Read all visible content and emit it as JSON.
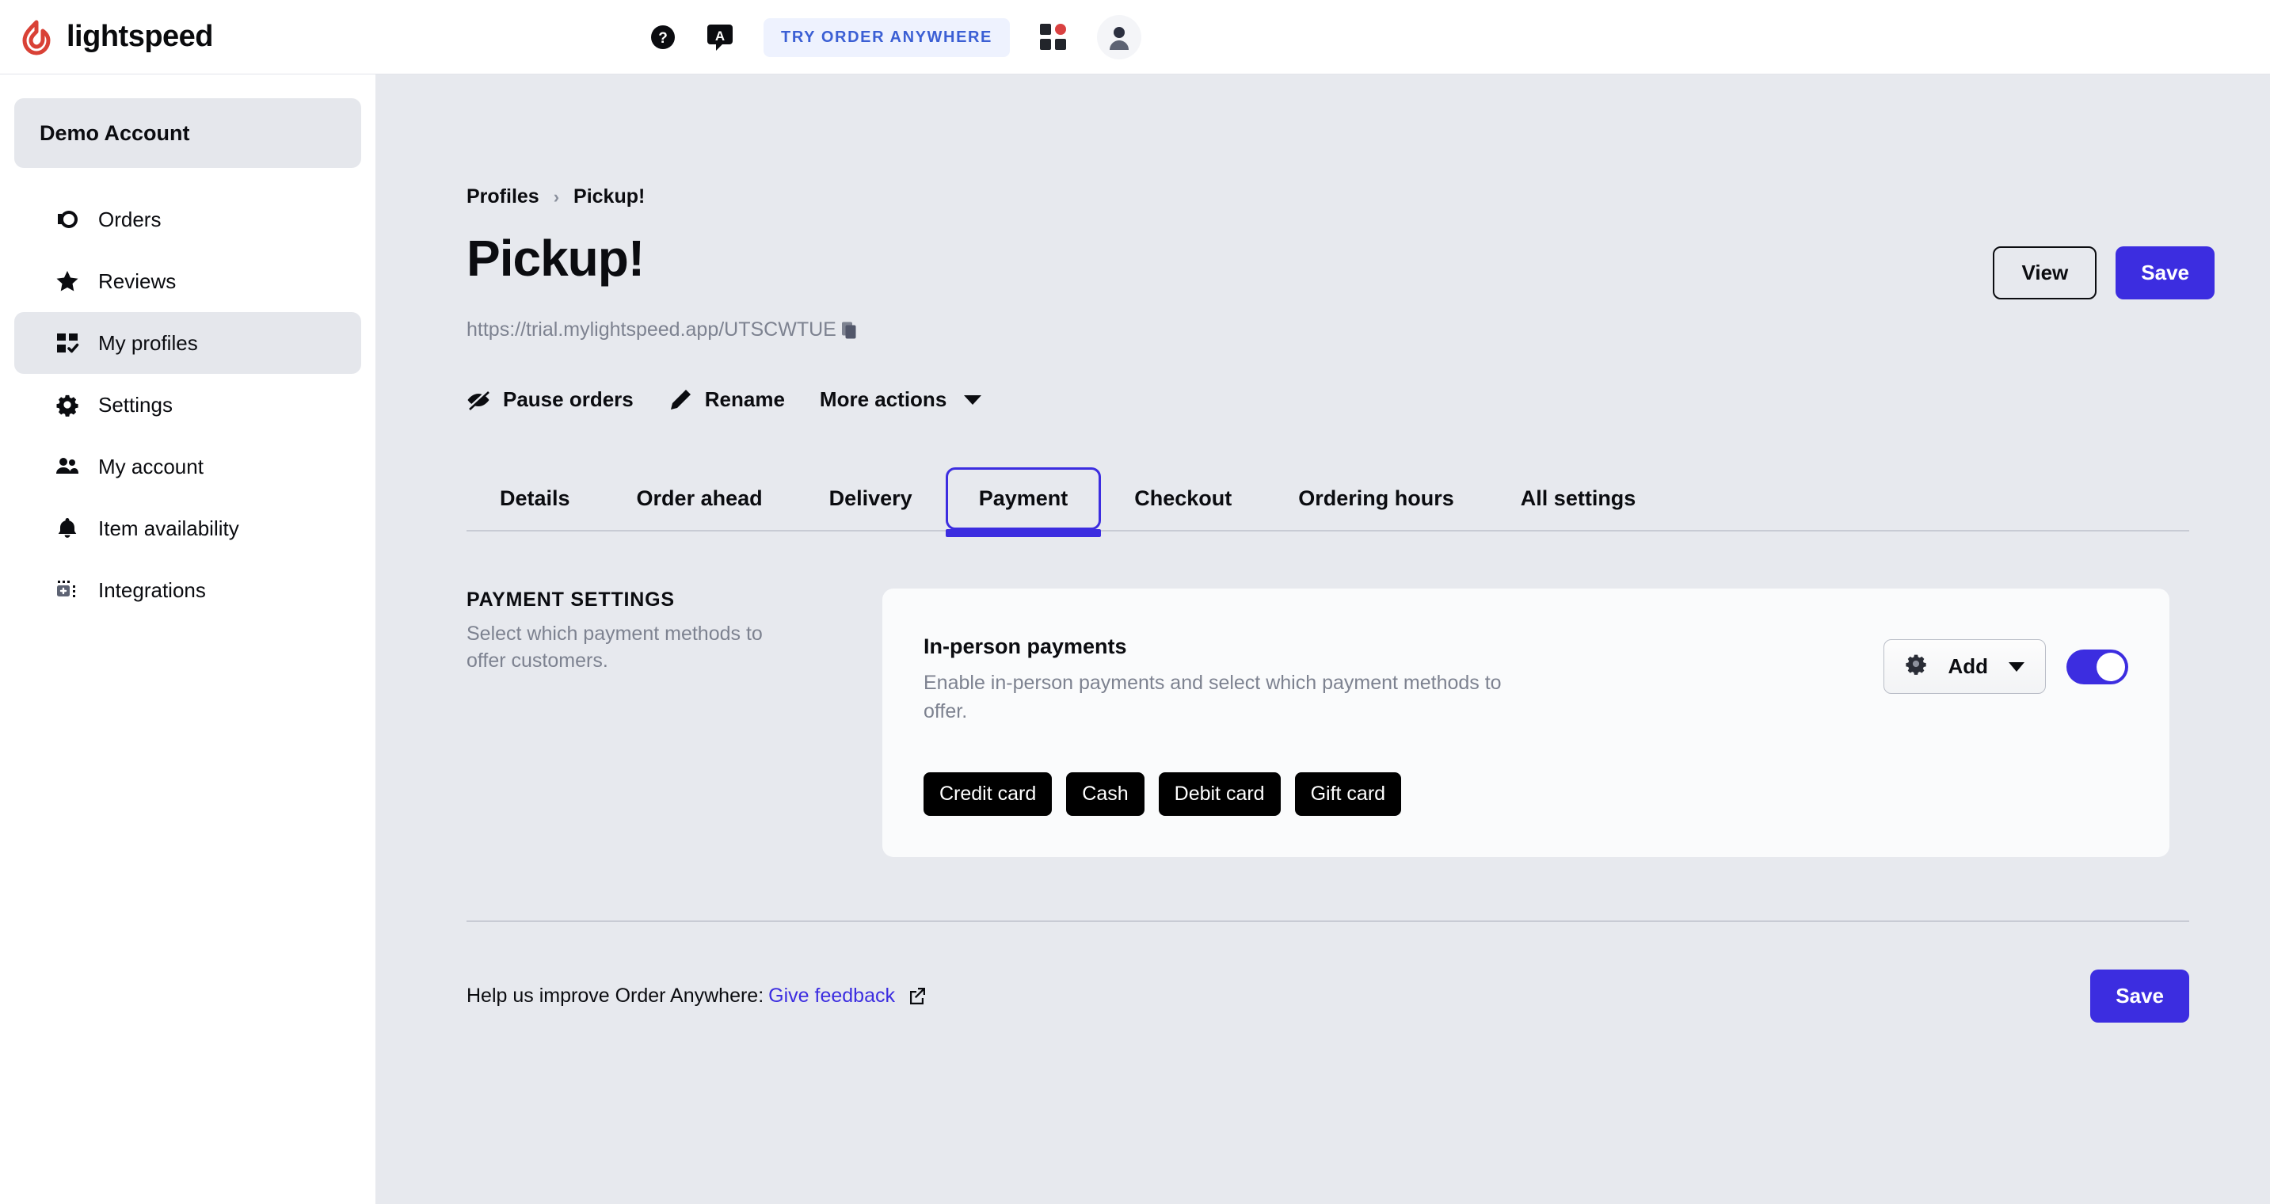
{
  "topbar": {
    "brand": "lightspeed",
    "help_icon": "help-circle-icon",
    "chat_icon": "chat-translate-icon",
    "try_button_label": "TRY ORDER ANYWHERE",
    "apps_icon": "app-switcher-grid-icon",
    "avatar_icon": "user-avatar-icon"
  },
  "sidebar": {
    "account_label": "Demo Account",
    "items": [
      {
        "label": "Orders",
        "icon": "orders-icon",
        "active": false
      },
      {
        "label": "Reviews",
        "icon": "star-icon",
        "active": false
      },
      {
        "label": "My profiles",
        "icon": "profiles-grid-icon",
        "active": true
      },
      {
        "label": "Settings",
        "icon": "gear-icon",
        "active": false
      },
      {
        "label": "My account",
        "icon": "people-icon",
        "active": false
      },
      {
        "label": "Item availability",
        "icon": "bell-icon",
        "active": false
      },
      {
        "label": "Integrations",
        "icon": "integrations-icon",
        "active": false
      }
    ]
  },
  "breadcrumb": {
    "parent": "Profiles",
    "separator": "›",
    "current": "Pickup!"
  },
  "header": {
    "title": "Pickup!",
    "url": "https://trial.mylightspeed.app/UTSCWTUE",
    "copy_icon": "copy-icon",
    "view_label": "View",
    "save_label": "Save"
  },
  "actions": [
    {
      "label": "Pause orders",
      "icon": "eye-slash-icon",
      "caret": false
    },
    {
      "label": "Rename",
      "icon": "pencil-icon",
      "caret": false
    },
    {
      "label": "More actions",
      "icon": "",
      "caret": true
    }
  ],
  "tabs": [
    {
      "label": "Details",
      "active": false
    },
    {
      "label": "Order ahead",
      "active": false
    },
    {
      "label": "Delivery",
      "active": false
    },
    {
      "label": "Payment",
      "active": true
    },
    {
      "label": "Checkout",
      "active": false
    },
    {
      "label": "Ordering hours",
      "active": false
    },
    {
      "label": "All settings",
      "active": false
    }
  ],
  "section": {
    "label": "PAYMENT SETTINGS",
    "description": "Select which payment methods to offer customers."
  },
  "card": {
    "title": "In-person payments",
    "description": "Enable in-person payments and select which payment methods to offer.",
    "gear_icon": "gear-icon",
    "add_label": "Add",
    "toggle_state": "on",
    "chips": [
      "Credit card",
      "Cash",
      "Debit card",
      "Gift card"
    ]
  },
  "footer": {
    "text": "Help us improve Order Anywhere:",
    "link_label": "Give feedback",
    "external_icon": "external-link-icon",
    "save_label": "Save"
  },
  "colors": {
    "accent": "#3c2de0",
    "brand_red": "#d94141",
    "page_bg": "#e7e9ee",
    "card_bg": "#fafbfc",
    "muted_text": "#7d8290"
  }
}
